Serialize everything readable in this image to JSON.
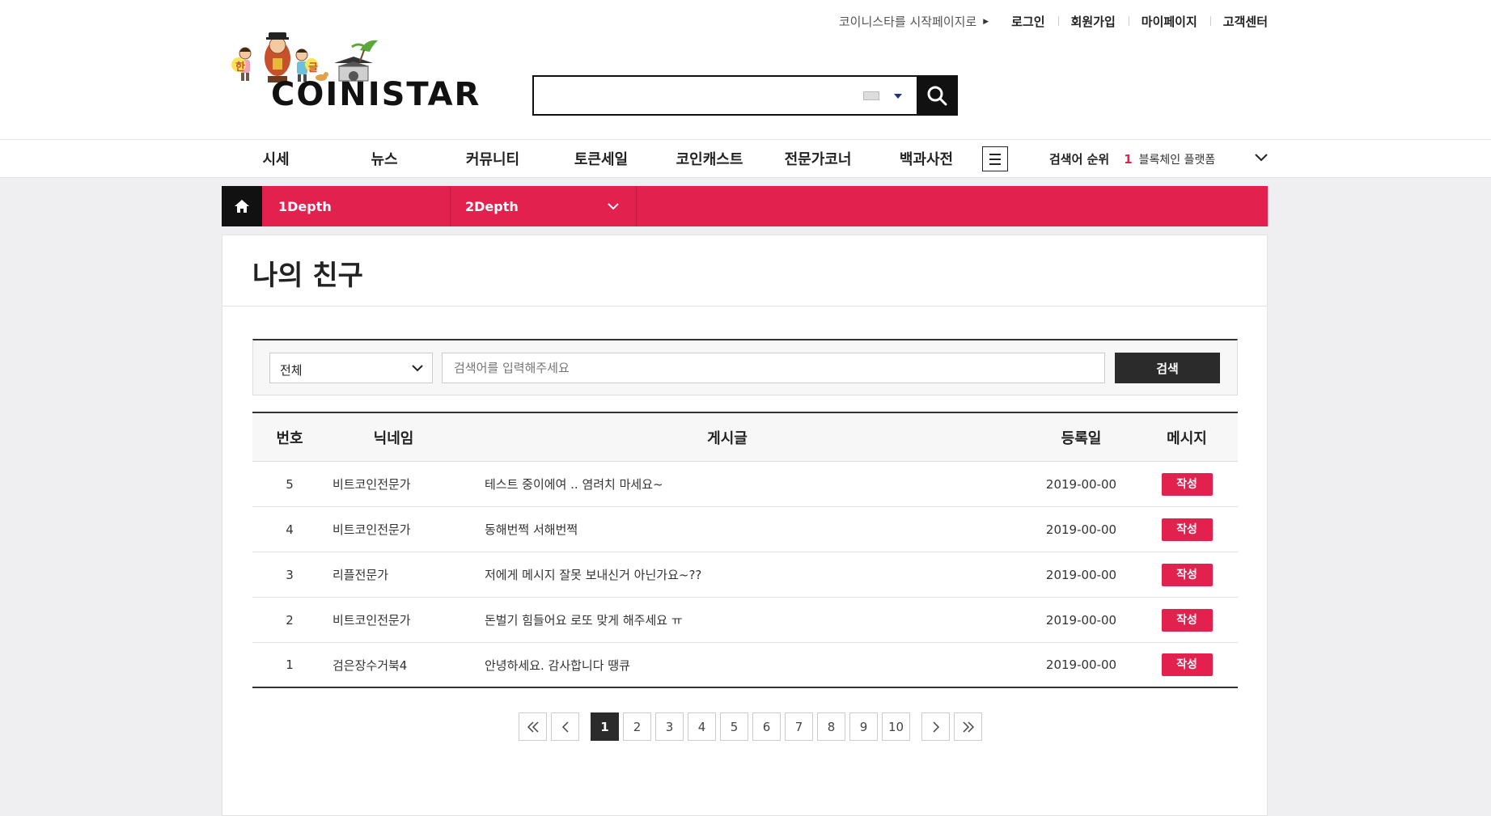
{
  "header": {
    "util": {
      "start_page": "코이니스타를 시작페이지로",
      "login": "로그인",
      "join": "회원가입",
      "mypage": "마이페이지",
      "support": "고객센터"
    },
    "logo_text": "COINISTAR",
    "logo_badge_1": "한",
    "logo_badge_2": "글",
    "search_icon": "search-icon"
  },
  "gnb": {
    "menu": [
      "시세",
      "뉴스",
      "커뮤니티",
      "토큰세일",
      "코인캐스트",
      "전문가코너",
      "백과사전"
    ],
    "rank_label": "검색어 순위",
    "rank_num": "1",
    "rank_keyword": "블록체인 플랫폼"
  },
  "location": {
    "depth1": "1Depth",
    "depth2": "2Depth"
  },
  "page": {
    "title": "나의 친구"
  },
  "search": {
    "select_value": "전체",
    "placeholder": "검색어를 입력해주세요",
    "button": "검색"
  },
  "table": {
    "headers": {
      "no": "번호",
      "nick": "닉네임",
      "post": "게시글",
      "date": "등록일",
      "msg": "메시지"
    },
    "rows": [
      {
        "no": "5",
        "nick": "비트코인전문가",
        "post": "테스트 중이에여 .. 염려치 마세요~",
        "date": "2019-00-00",
        "btn": "작성"
      },
      {
        "no": "4",
        "nick": "비트코인전문가",
        "post": "동해번쩍 서해번쩍",
        "date": "2019-00-00",
        "btn": "작성"
      },
      {
        "no": "3",
        "nick": "리플전문가",
        "post": "저에게 메시지 잘못 보내신거 아닌가요~??",
        "date": "2019-00-00",
        "btn": "작성"
      },
      {
        "no": "2",
        "nick": "비트코인전문가",
        "post": "돈벌기 힘들어요 로또 맞게 해주세요 ㅠ",
        "date": "2019-00-00",
        "btn": "작성"
      },
      {
        "no": "1",
        "nick": "검은장수거북4",
        "post": "안녕하세요. 감사합니다 땡큐",
        "date": "2019-00-00",
        "btn": "작성"
      }
    ]
  },
  "pagination": {
    "pages": [
      "1",
      "2",
      "3",
      "4",
      "5",
      "6",
      "7",
      "8",
      "9",
      "10"
    ],
    "current": "1"
  },
  "colors": {
    "accent": "#e3214f",
    "dark": "#2b2b2b"
  }
}
